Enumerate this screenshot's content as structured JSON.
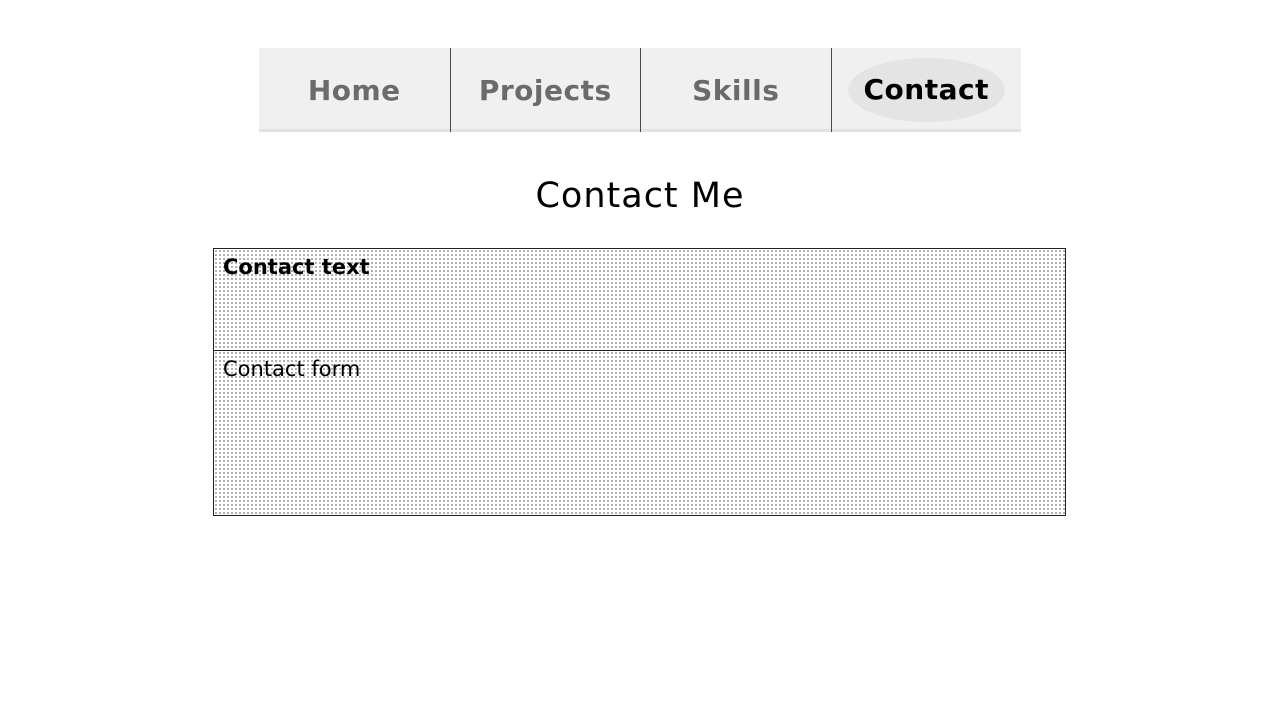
{
  "nav": {
    "items": [
      {
        "label": "Home",
        "active": false
      },
      {
        "label": "Projects",
        "active": false
      },
      {
        "label": "Skills",
        "active": false
      },
      {
        "label": "Contact",
        "active": true
      }
    ]
  },
  "page": {
    "title": "Contact Me"
  },
  "sections": {
    "contact_text": {
      "label": "Contact text"
    },
    "contact_form": {
      "label": "Contact form"
    }
  }
}
